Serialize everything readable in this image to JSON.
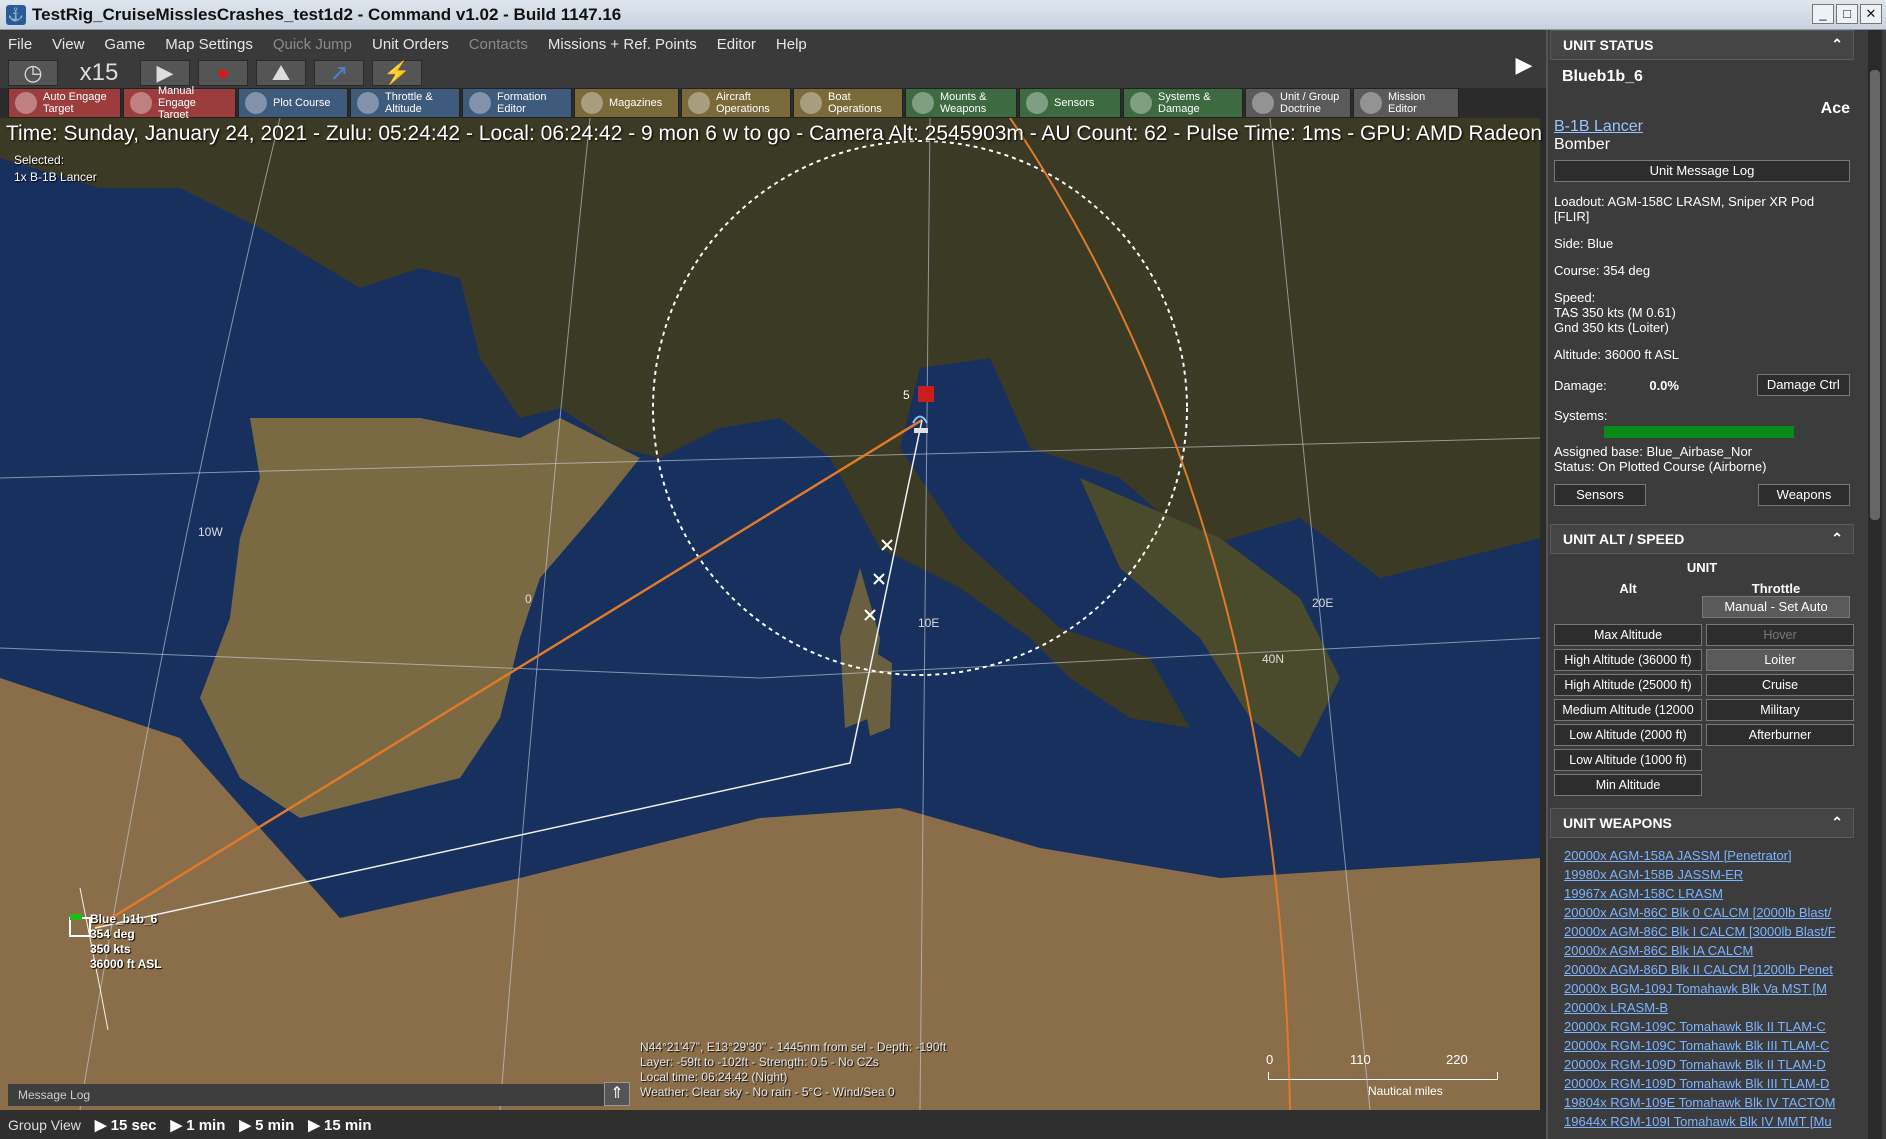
{
  "window": {
    "title": "TestRig_CruiseMisslesCrashes_test1d2 - Command v1.02 - Build 1147.16"
  },
  "menu": [
    {
      "label": "File",
      "enabled": true
    },
    {
      "label": "View",
      "enabled": true
    },
    {
      "label": "Game",
      "enabled": true
    },
    {
      "label": "Map Settings",
      "enabled": true
    },
    {
      "label": "Quick Jump",
      "enabled": false
    },
    {
      "label": "Unit Orders",
      "enabled": true
    },
    {
      "label": "Contacts",
      "enabled": false
    },
    {
      "label": "Missions + Ref. Points",
      "enabled": true
    },
    {
      "label": "Editor",
      "enabled": true
    },
    {
      "label": "Help",
      "enabled": true
    }
  ],
  "timecontrols": {
    "compression": "x15"
  },
  "toolbar": [
    {
      "label": "Auto Engage Target",
      "color": "red"
    },
    {
      "label": "Manual Engage Target",
      "color": "red"
    },
    {
      "label": "Plot Course",
      "color": "blue"
    },
    {
      "label": "Throttle & Altitude",
      "color": "blue"
    },
    {
      "label": "Formation Editor",
      "color": "blue"
    },
    {
      "label": "Magazines",
      "color": "gold"
    },
    {
      "label": "Aircraft Operations",
      "color": "gold"
    },
    {
      "label": "Boat Operations",
      "color": "gold"
    },
    {
      "label": "Mounts & Weapons",
      "color": "green"
    },
    {
      "label": "Sensors",
      "color": "green"
    },
    {
      "label": "Systems & Damage",
      "color": "green"
    },
    {
      "label": "Unit / Group Doctrine",
      "color": "gray"
    },
    {
      "label": "Mission Editor",
      "color": "gray"
    }
  ],
  "map": {
    "infoline": "Time: Sunday, January 24, 2021 - Zulu: 05:24:42 - Local: 06:24:42 - 9 mon 6 w to go -  Camera Alt: 2545903m  - AU Count: 62 - Pulse Time: 1ms - GPU: AMD Radeon R",
    "selected_label": "Selected:",
    "selected_value": "1x B-1B Lancer",
    "gridlabels": {
      "w10": "10W",
      "zero": "0",
      "e10": "10E",
      "e20": "20E",
      "n40": "40N"
    },
    "unit_label": {
      "name": "Blue_b1b_6",
      "course": "354 deg",
      "speed": "350 kts",
      "alt": "36000 ft ASL"
    },
    "marker_count": "5",
    "cursor_info": [
      "N44°21'47\", E13°29'30\" - 1445nm from sel - Depth: -190ft",
      "Layer: -59ft to -102ft - Strength: 0.5 - No CZs",
      "Local time: 06:24:42 (Night)",
      "Weather: Clear sky - No rain - 5°C - Wind/Sea 0"
    ],
    "scale": {
      "t0": "0",
      "t1": "110",
      "t2": "220",
      "unit": "Nautical miles"
    },
    "message_log": "Message Log"
  },
  "bottombar": {
    "group_view": "Group View",
    "steps": [
      "15 sec",
      "1 min",
      "5 min",
      "15 min"
    ]
  },
  "panel": {
    "status_header": "UNIT STATUS",
    "unit_name": "Blueb1b_6",
    "proficiency": "Ace",
    "class_link": "B-1B Lancer",
    "unit_type": "Bomber",
    "message_log_button": "Unit Message Log",
    "loadout": "Loadout: AGM-158C LRASM, Sniper XR Pod [FLIR]",
    "side": "Side: Blue",
    "course": "Course: 354 deg",
    "speed_label": "Speed:",
    "tas": "TAS 350 kts (M 0.61)",
    "gnd": "Gnd 350 kts (Loiter)",
    "altitude": "Altitude: 36000 ft ASL",
    "damage_label": "Damage:",
    "damage_value": "0.0%",
    "damage_button": "Damage Ctrl",
    "systems_label": "Systems:",
    "systems_level": 1.0,
    "assigned_base": "Assigned base: Blue_Airbase_Nor",
    "status": "Status: On Plotted Course (Airborne)",
    "sensors_button": "Sensors",
    "weapons_button": "Weapons",
    "altspeed_header": "UNIT ALT / SPEED",
    "unit_toggle": "UNIT",
    "alt_col": "Alt",
    "throttle_col": "Throttle",
    "manual_button": "Manual - Set Auto",
    "alt_buttons": [
      "Max Altitude",
      "High Altitude (36000 ft)",
      "High Altitude (25000 ft)",
      "Medium Altitude (12000",
      "Low Altitude (2000 ft)",
      "Low Altitude (1000 ft)",
      "Min Altitude"
    ],
    "throttle_buttons": [
      "Hover",
      "Loiter",
      "Cruise",
      "Military",
      "Afterburner"
    ],
    "weapons_header": "UNIT WEAPONS",
    "weapons": [
      "20000x AGM-158A JASSM [Penetrator]",
      "19980x AGM-158B JASSM-ER",
      "19967x AGM-158C LRASM",
      "20000x AGM-86C Blk 0 CALCM [2000lb Blast/",
      "20000x AGM-86C Blk I CALCM [3000lb Blast/F",
      "20000x AGM-86C Blk IA CALCM",
      "20000x AGM-86D Blk II CALCM [1200lb Penet",
      "20000x BGM-109J Tomahawk Blk Va MST [M",
      "20000x LRASM-B",
      "20000x RGM-109C Tomahawk Blk II TLAM-C",
      "20000x RGM-109C Tomahawk Blk III TLAM-C",
      "20000x RGM-109D Tomahawk Blk II TLAM-D",
      "20000x RGM-109D Tomahawk Blk III TLAM-D",
      "19804x RGM-109E Tomahawk Blk IV TACTOM",
      "19644x RGM-109I Tomahawk Blk IV MMT [Mu"
    ]
  }
}
